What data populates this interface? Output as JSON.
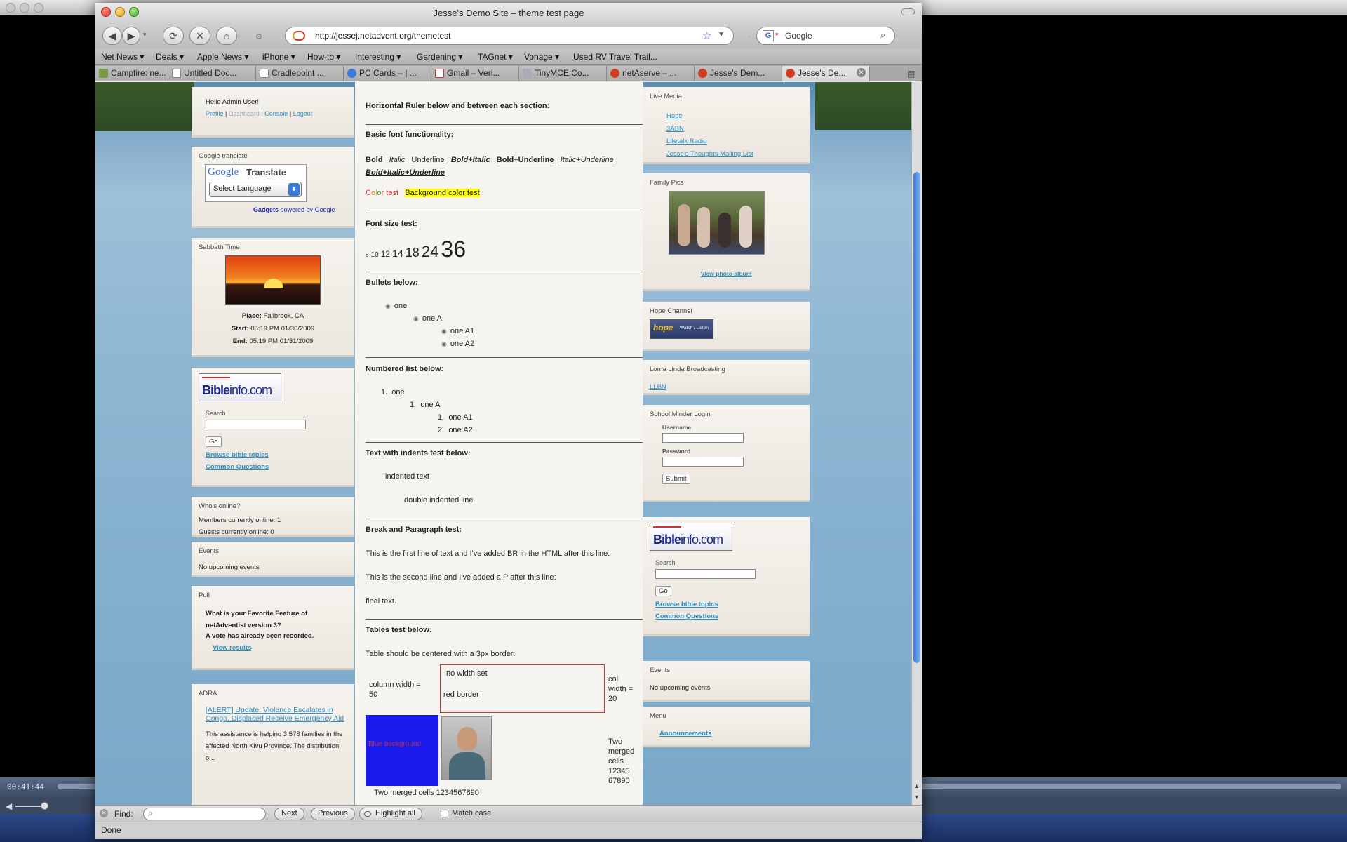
{
  "window": {
    "title": "Jesse's Demo Site – theme test page"
  },
  "toolbar": {
    "url": "http://jessej.netadvent.org/themetest",
    "search_placeholder": "Google"
  },
  "bookmarks": [
    "Net News ▾",
    "Deals ▾",
    "Apple News ▾",
    "iPhone ▾",
    "How-to ▾",
    "Interesting ▾",
    "Gardening ▾",
    "TAGnet ▾",
    "Vonage ▾",
    "Used RV Travel Trail..."
  ],
  "tabs": [
    "Campfire: ne...",
    "Untitled Doc...",
    "Cradlepoint ...",
    "PC Cards – | ...",
    "Gmail – Veri...",
    "TinyMCE:Co...",
    "netAserve – ...",
    "Jesse's Dem...",
    "Jesse's De..."
  ],
  "left": {
    "user": {
      "greeting": "Hello Admin User!",
      "profile": "Profile",
      "dashboard": "Dashboard",
      "console": "Console",
      "logout": "Logout",
      "sep": "|"
    },
    "translate": {
      "title": "Google translate",
      "brand_google": "Google",
      "brand_translate": " Translate",
      "select": "Select Language",
      "gadgets": "Gadgets",
      "powered": " powered by Google"
    },
    "sabbath": {
      "title": "Sabbath Time",
      "place_label": "Place:",
      "place": "Fallbrook, CA",
      "start_label": "Start:",
      "start": "05:19 PM 01/30/2009",
      "end_label": "End:",
      "end": "05:19 PM 01/31/2009"
    },
    "bible": {
      "logo_a": "Bible",
      "logo_b": "info.com",
      "search_label": "Search",
      "go": "Go",
      "browse": "Browse bible topics",
      "common": "Common Questions"
    },
    "online": {
      "title": "Who's online?",
      "members": "Members currently online: 1",
      "guests": "Guests currently online: 0"
    },
    "events": {
      "title": "Events",
      "text": "No upcoming events"
    },
    "poll": {
      "title": "Poll",
      "question": "What is your Favorite Feature of netAdventist version 3?",
      "recorded": "A vote has already been recorded.",
      "results": "View results"
    },
    "adra": {
      "title": "ADRA",
      "headline": "[ALERT] Update: Violence Escalates in Congo, Displaced Receive Emergency Aid",
      "text": "This assistance is helping 3,578 families in the affected North Kivu Province. The distribution o..."
    }
  },
  "main": {
    "hr_heading": "Horizontal Ruler below and between each section:",
    "font_heading": "Basic font functionality:",
    "bold": "Bold",
    "italic": "Italic",
    "underline": "Underline",
    "bold_italic": "Bold+Italic",
    "bold_underline": "Bold+Underline",
    "italic_underline": "Italic+Underline",
    "bold_italic_underline": "Bold+Italic+Underline",
    "color_c": "C",
    "color_o": "o",
    "color_l": "l",
    "color_o2": "o",
    "color_r": "r",
    "color_test": " test",
    "bg_color_test": "Background color test",
    "font_size_heading": "Font size test:",
    "sizes": [
      "8",
      "10",
      "12",
      "14",
      "18",
      "24",
      "36"
    ],
    "bullets_heading": "Bullets below:",
    "bullets": [
      "one",
      "one A",
      "one A1",
      "one A2"
    ],
    "numbered_heading": "Numbered list below:",
    "numbered": [
      "1.",
      "one",
      "1.",
      "one A",
      "1.",
      "one A1",
      "2.",
      "one A2"
    ],
    "indent_heading": "Text with indents test below:",
    "indent1": "indented text",
    "indent2": "double indented line",
    "break_heading": "Break and Paragraph test:",
    "br_line": "This is the first line of text and I've added BR in the HTML after this line:",
    "p_line": "This is the second line and I've added a P after this line:",
    "final": "final text.",
    "tables_heading": "Tables test below:",
    "table_note": "Table should be centered with a 3px border:",
    "cell_col50": "column width = 50",
    "cell_nowidth": "no width set",
    "cell_redborder": "red border",
    "cell_col20": "col width = 20",
    "cell_blue": "Blue background",
    "cell_merged_right": "Two merged cells 12345 67890",
    "cell_merged_bottom": "Two merged cells 1234567890"
  },
  "right": {
    "live": {
      "title": "Live Media",
      "links": [
        "Hope",
        "3ABN",
        "Lifetalk Radio",
        "Jesse's Thoughts Mailing List"
      ]
    },
    "family": {
      "title": "Family Pics",
      "album": "View photo album"
    },
    "hope": {
      "title": "Hope Channel",
      "badge": "Watch / Listen",
      "badge_logo": "hope"
    },
    "loma": {
      "title": "Loma Linda Broadcasting",
      "link": "LLBN"
    },
    "school": {
      "title": "School Minder Login",
      "username": "Username",
      "password": "Password",
      "submit": "Submit"
    },
    "bible": {
      "logo_a": "Bible",
      "logo_b": "info.com",
      "search_label": "Search",
      "go": "Go",
      "browse": "Browse bible topics",
      "common": "Common Questions"
    },
    "events": {
      "title": "Events",
      "text": "No upcoming events"
    },
    "menu": {
      "title": "Menu",
      "link": "Announcements"
    }
  },
  "find": {
    "label": "Find:",
    "next": "Next",
    "previous": "Previous",
    "highlight": "Highlight all",
    "match": "Match case"
  },
  "status": "Done",
  "media": {
    "time": "00:41:44"
  }
}
